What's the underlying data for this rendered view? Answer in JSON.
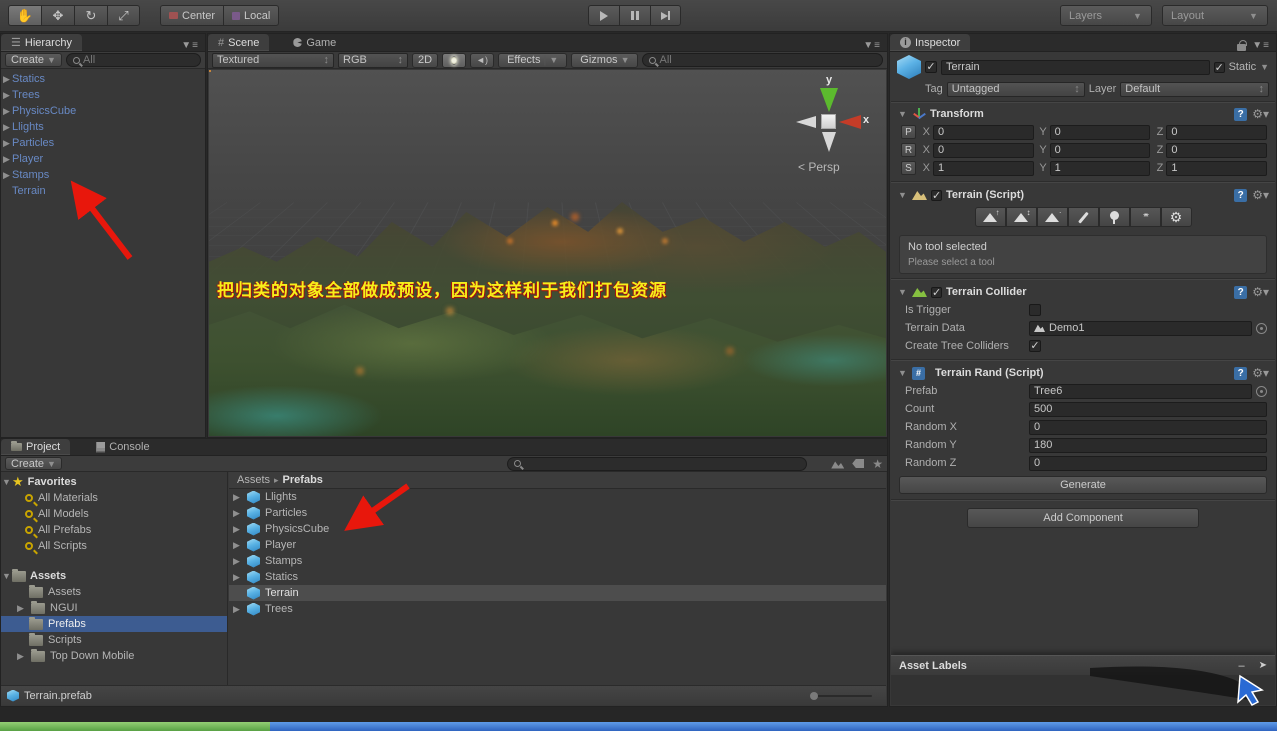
{
  "toolbar": {
    "center_label": "Center",
    "local_label": "Local",
    "layers_label": "Layers",
    "layout_label": "Layout"
  },
  "hierarchy": {
    "tab": "Hierarchy",
    "create_label": "Create",
    "search_placeholder": "All",
    "items": [
      {
        "label": "Statics",
        "expandable": true
      },
      {
        "label": "Trees",
        "expandable": true
      },
      {
        "label": "PhysicsCube",
        "expandable": true
      },
      {
        "label": "Llights",
        "expandable": true
      },
      {
        "label": "Particles",
        "expandable": true
      },
      {
        "label": "Player",
        "expandable": true
      },
      {
        "label": "Stamps",
        "expandable": true
      },
      {
        "label": "Terrain",
        "expandable": false
      }
    ]
  },
  "scene": {
    "tab_scene": "Scene",
    "tab_game": "Game",
    "draw_mode": "Textured",
    "channels": "RGB",
    "mode_2d": "2D",
    "effects_label": "Effects",
    "gizmos_label": "Gizmos",
    "search_placeholder": "All",
    "gizmo": {
      "axis_y": "y",
      "axis_x": "x",
      "persp_label": "Persp",
      "persp_arrow": "<"
    },
    "annotation": "把归类的对象全部做成预设，因为这样利于我们打包资源"
  },
  "project": {
    "tab_project": "Project",
    "tab_console": "Console",
    "create_label": "Create",
    "favorites": {
      "label": "Favorites",
      "items": [
        "All Materials",
        "All Models",
        "All Prefabs",
        "All Scripts"
      ]
    },
    "assets_root": "Assets",
    "assets_children": [
      {
        "label": "Assets",
        "expandable": false,
        "selected": false
      },
      {
        "label": "NGUI",
        "expandable": true,
        "selected": false
      },
      {
        "label": "Prefabs",
        "expandable": false,
        "selected": true
      },
      {
        "label": "Scripts",
        "expandable": false,
        "selected": false
      },
      {
        "label": "Top Down Mobile",
        "expandable": true,
        "selected": false
      }
    ],
    "breadcrumb": {
      "root": "Assets",
      "current": "Prefabs"
    },
    "files": [
      {
        "label": "Llights",
        "expandable": true,
        "selected": false
      },
      {
        "label": "Particles",
        "expandable": true,
        "selected": false
      },
      {
        "label": "PhysicsCube",
        "expandable": true,
        "selected": false
      },
      {
        "label": "Player",
        "expandable": true,
        "selected": false
      },
      {
        "label": "Stamps",
        "expandable": true,
        "selected": false
      },
      {
        "label": "Statics",
        "expandable": true,
        "selected": false
      },
      {
        "label": "Terrain",
        "expandable": false,
        "selected": true
      },
      {
        "label": "Trees",
        "expandable": true,
        "selected": false
      }
    ],
    "footer_file": "Terrain.prefab"
  },
  "inspector": {
    "tab": "Inspector",
    "header": {
      "name": "Terrain",
      "static_label": "Static",
      "tag_label": "Tag",
      "tag_value": "Untagged",
      "layer_label": "Layer",
      "layer_value": "Default"
    },
    "transform": {
      "title": "Transform",
      "rows": [
        {
          "key": "P",
          "x": "0",
          "y": "0",
          "z": "0"
        },
        {
          "key": "R",
          "x": "0",
          "y": "0",
          "z": "0"
        },
        {
          "key": "S",
          "x": "1",
          "y": "1",
          "z": "1"
        }
      ],
      "axis_labels": {
        "x": "X",
        "y": "Y",
        "z": "Z"
      }
    },
    "terrain_script": {
      "title": "Terrain (Script)",
      "no_tool": "No tool selected",
      "select_tool": "Please select a tool"
    },
    "terrain_collider": {
      "title": "Terrain Collider",
      "is_trigger_label": "Is Trigger",
      "terrain_data_label": "Terrain Data",
      "terrain_data_value": "Demo1",
      "create_tree_label": "Create Tree Colliders",
      "create_tree_checked": "✓"
    },
    "terrain_rand": {
      "title": "Terrain Rand (Script)",
      "prefab_label": "Prefab",
      "prefab_value": "Tree6",
      "count_label": "Count",
      "count_value": "500",
      "random_x_label": "Random X",
      "random_x_value": "0",
      "random_y_label": "Random Y",
      "random_y_value": "180",
      "random_z_label": "Random Z",
      "random_z_value": "0",
      "generate_label": "Generate"
    },
    "add_component_label": "Add Component",
    "asset_labels_title": "Asset Labels"
  },
  "colors": {
    "selection_blue": "#3d5c91",
    "selection_gray": "#4d4d4d",
    "prefab_text_blue": "#6889c4",
    "annotation_yellow": "#f6ef1a",
    "arrow_red": "#e8170c"
  },
  "glyphs": {
    "checked": "✓",
    "tri_right": "▶",
    "tri_down": "▼",
    "crumb_sep": "▸",
    "updown": "↕",
    "dropdown": "▼",
    "menu": "▼≡"
  }
}
